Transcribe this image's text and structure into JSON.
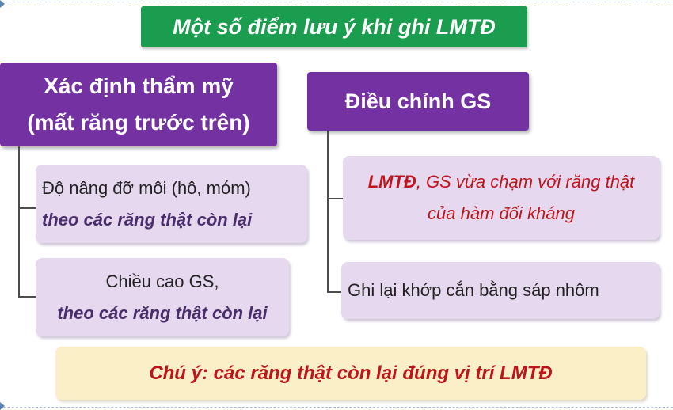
{
  "title": "Một số điểm lưu ý khi ghi LMTĐ",
  "left": {
    "header_line1": "Xác định thẩm mỹ",
    "header_line2": "(mất răng trước trên)",
    "item1_line1": "Độ nâng đỡ môi (hô, móm)",
    "item1_line2": "theo các răng thật còn lại",
    "item2_line1": "Chiều cao GS,",
    "item2_line2": "theo các răng thật còn lại"
  },
  "right": {
    "header": "Điều chỉnh GS",
    "item1_bold": "LMTĐ",
    "item1_rest": ", GS vừa chạm với răng thật",
    "item1_line2": "của hàm đối kháng",
    "item2": "Ghi lại khớp cắn bằng sáp nhôm"
  },
  "note": "Chú ý: các răng thật còn lại đúng vị trí LMTĐ",
  "colors": {
    "title_bg": "#1a9d4f",
    "header_bg": "#7431a1",
    "item_bg": "#e6d9ef",
    "note_bg": "#fbefc7",
    "accent_red": "#c0141c"
  }
}
